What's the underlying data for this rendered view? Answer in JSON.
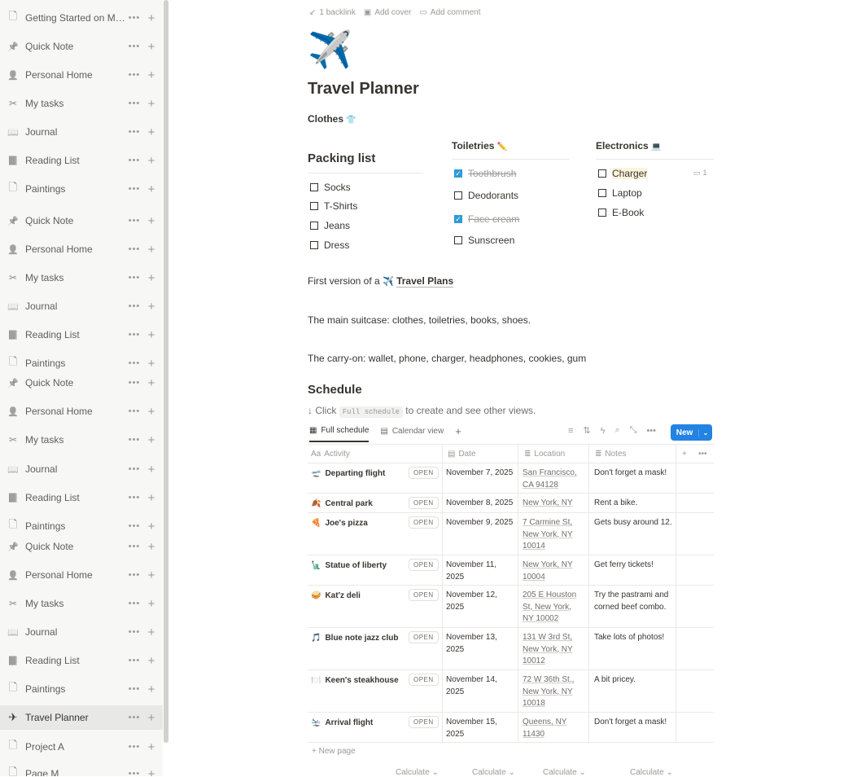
{
  "sidebar": {
    "items": [
      {
        "label": "Getting Started on Mo...",
        "icon": "page-icon"
      },
      {
        "label": "Quick Note",
        "icon": "pin-icon"
      },
      {
        "label": "Personal Home",
        "icon": "person-icon"
      },
      {
        "label": "My tasks",
        "icon": "scissors-icon"
      },
      {
        "label": "Journal",
        "icon": "book-open-icon"
      },
      {
        "label": "Reading List",
        "icon": "book-icon"
      },
      {
        "label": "Paintings",
        "icon": "page-icon"
      },
      {
        "label": "Quick Note",
        "icon": "pin-icon"
      },
      {
        "label": "Personal Home",
        "icon": "person-icon"
      },
      {
        "label": "My tasks",
        "icon": "scissors-icon"
      },
      {
        "label": "Journal",
        "icon": "book-open-icon"
      },
      {
        "label": "Reading List",
        "icon": "book-icon"
      },
      {
        "label": "Paintings",
        "icon": "page-icon"
      },
      {
        "label": "Quick Note",
        "icon": "pin-icon"
      },
      {
        "label": "Personal Home",
        "icon": "person-icon"
      },
      {
        "label": "My tasks",
        "icon": "scissors-icon"
      },
      {
        "label": "Journal",
        "icon": "book-open-icon"
      },
      {
        "label": "Reading List",
        "icon": "book-icon"
      },
      {
        "label": "Paintings",
        "icon": "page-icon"
      },
      {
        "label": "Quick Note",
        "icon": "pin-icon"
      },
      {
        "label": "Personal Home",
        "icon": "person-icon"
      },
      {
        "label": "My tasks",
        "icon": "scissors-icon"
      },
      {
        "label": "Journal",
        "icon": "book-open-icon"
      },
      {
        "label": "Reading List",
        "icon": "book-icon"
      },
      {
        "label": "Paintings",
        "icon": "page-icon"
      },
      {
        "label": "Travel Planner",
        "icon": "airplane-icon",
        "active": true
      },
      {
        "label": "Project A",
        "icon": "page-icon"
      },
      {
        "label": "Page M",
        "icon": "page-icon"
      }
    ],
    "more_glyph": "•••",
    "add_glyph": "+"
  },
  "toolbar": {
    "backlink": "1 backlink",
    "add_cover": "Add cover",
    "add_comment": "Add comment"
  },
  "page": {
    "icon": "✈️",
    "title": "Travel Planner",
    "clothes_label": "Clothes",
    "clothes_emoji": "👕"
  },
  "packing": {
    "heading": "Packing list",
    "items": [
      {
        "label": "Socks",
        "checked": false
      },
      {
        "label": "T-Shirts",
        "checked": false
      },
      {
        "label": "Jeans",
        "checked": false
      },
      {
        "label": "Dress",
        "checked": false
      }
    ]
  },
  "toiletries": {
    "heading": "Toiletries",
    "emoji": "✏️",
    "items": [
      {
        "label": "Toothbrush",
        "checked": true
      },
      {
        "label": "Deodorants",
        "checked": false
      },
      {
        "label": "Face cream",
        "checked": true
      },
      {
        "label": "Sunscreen",
        "checked": false
      }
    ]
  },
  "electronics": {
    "heading": "Electronics",
    "emoji": "💻",
    "items": [
      {
        "label": "Charger",
        "checked": false
      },
      {
        "label": "Laptop",
        "checked": false
      },
      {
        "label": "E-Book",
        "checked": false
      }
    ],
    "comment_count": "1"
  },
  "paragraphs": {
    "first_version_prefix": "First version of a",
    "travel_plans_link": "Travel Plans",
    "main_suitcase": "The main suitcase: clothes, toiletries, books, shoes.",
    "carry_on": "The carry-on: wallet, phone, charger, headphones, cookies, gum"
  },
  "schedule": {
    "heading": "Schedule",
    "hint_prefix": "↓ Click",
    "hint_code": "Full schedule",
    "hint_suffix": "to create and see other views.",
    "tabs": [
      {
        "label": "Full schedule",
        "active": true
      },
      {
        "label": "Calendar view",
        "active": false
      }
    ],
    "add_view": "+",
    "new_button": "New",
    "columns": {
      "activity": "Activity",
      "date": "Date",
      "location": "Location",
      "notes": "Notes"
    },
    "open_label": "OPEN",
    "rows": [
      {
        "emoji": "🛫",
        "activity": "Departing flight",
        "date": "November 7, 2025",
        "location": "San Francisco, CA 94128",
        "notes": "Don't forget a mask!"
      },
      {
        "emoji": "🍂",
        "activity": "Central park",
        "date": "November 8, 2025",
        "location": "New York, NY",
        "notes": "Rent a bike."
      },
      {
        "emoji": "🍕",
        "activity": "Joe's pizza",
        "date": "November 9, 2025",
        "location": "7 Carmine St, New York, NY 10014",
        "notes": "Gets busy around 12."
      },
      {
        "emoji": "🗽",
        "activity": "Statue of liberty",
        "date": "November 11, 2025",
        "location": "New York, NY 10004",
        "notes": "Get ferry tickets!"
      },
      {
        "emoji": "🥪",
        "activity": "Kat'z deli",
        "date": "November 12, 2025",
        "location": "205 E Houston St, New York, NY 10002",
        "notes": "Try the pastrami and corned beef combo."
      },
      {
        "emoji": "🎵",
        "activity": "Blue note jazz club",
        "date": "November 13, 2025",
        "location": "131 W 3rd St, New York, NY 10012",
        "notes": "Take lots of photos!"
      },
      {
        "emoji": "🍽️",
        "activity": "Keen's steakhouse",
        "date": "November 14, 2025",
        "location": "72 W 36th St., New York, NY 10018",
        "notes": "A bit pricey."
      },
      {
        "emoji": "🛬",
        "activity": "Arrival flight",
        "date": "November 15, 2025",
        "location": "Queens, NY 11430",
        "notes": "Don't forget a mask!"
      }
    ],
    "new_page": "New page",
    "calculate": "Calculate"
  },
  "colors": {
    "accent": "#2383e2",
    "checkbox_checked": "#2e9bd6",
    "sidebar_bg": "#f7f7f5",
    "text": "#37352f"
  }
}
